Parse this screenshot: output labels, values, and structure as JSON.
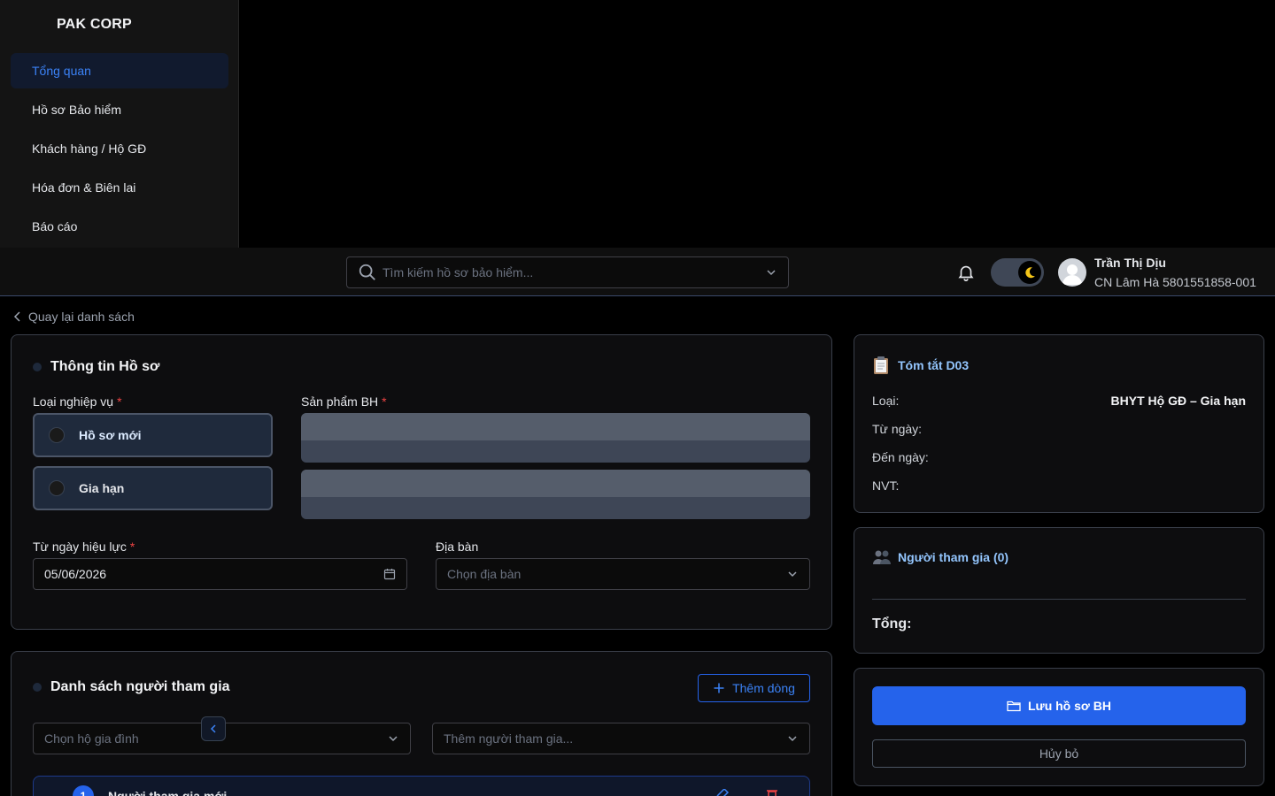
{
  "brand": "PAK CORP",
  "sidebar": {
    "items": [
      {
        "label": "Tổng quan"
      },
      {
        "label": "Hồ sơ Bảo hiểm"
      },
      {
        "label": "Khách hàng / Hộ GĐ"
      },
      {
        "label": "Hóa đơn & Biên lai"
      },
      {
        "label": "Báo cáo"
      }
    ]
  },
  "topbar": {
    "search_placeholder": "Tìm kiếm hồ sơ bảo hiểm...",
    "user_name": "Trần Thị Dịu",
    "user_sub": "CN Lâm Hà 5801551858-001",
    "theme_mode": "dark"
  },
  "back_link": "Quay lại danh sách",
  "form": {
    "title": "Thông tin Hồ sơ",
    "type_label": "Loại nghiệp vụ",
    "type_options": [
      "Hồ sơ mới",
      "Gia hạn"
    ],
    "product_label": "Sản phẩm BH",
    "from_date_label": "Từ ngày hiệu lực",
    "from_date_value": "05/06/2026",
    "area_label": "Địa bàn",
    "area_placeholder": "Chọn địa bàn",
    "required_mark": "*"
  },
  "participants": {
    "title": "Danh sách người tham gia",
    "add_row": "Thêm dòng",
    "household_placeholder": "Chọn hộ gia đình",
    "add_participant_placeholder": "Thêm người tham gia...",
    "row_number": "1",
    "row_title": "Người tham gia mới"
  },
  "summary": {
    "title": "Tóm tắt D03",
    "type_label": "Loại:",
    "type_value": "BHYT Hộ GĐ – Gia hạn",
    "from_label": "Từ ngày:",
    "to_label": "Đến ngày:",
    "nvt_label": "NVT:"
  },
  "participants_summary": {
    "title": "Người tham gia (0)",
    "total_label": "Tổng:"
  },
  "actions": {
    "save": "Lưu hồ sơ BH",
    "cancel": "Hủy bỏ"
  },
  "colors": {
    "accent": "#2563eb",
    "required": "#ef4444",
    "summary_title": "#93c5fd"
  }
}
